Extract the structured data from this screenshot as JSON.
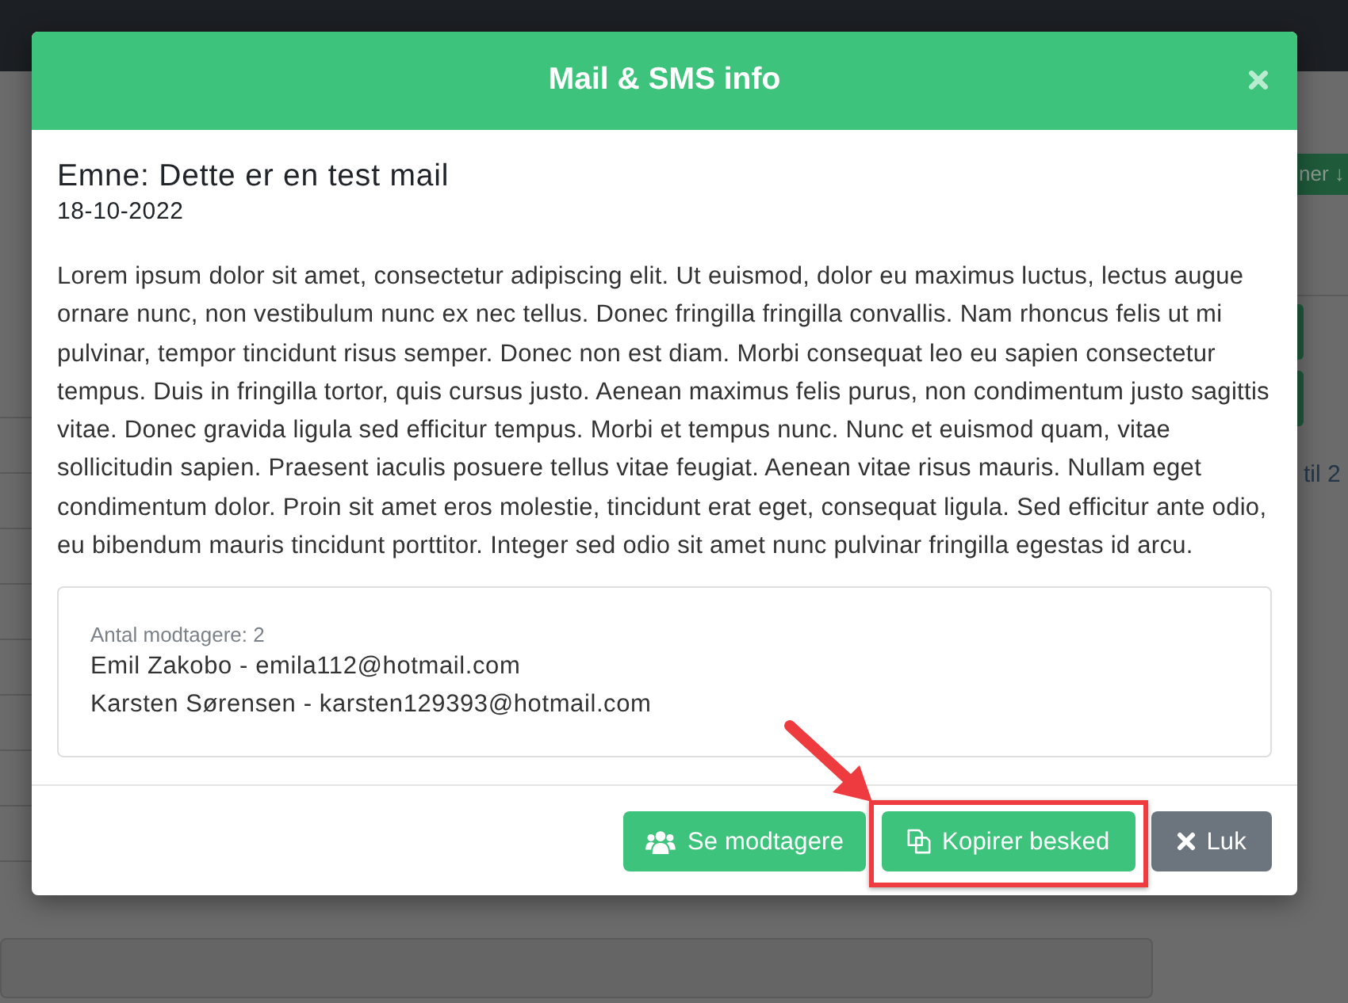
{
  "background": {
    "header_button": "ner ↓",
    "text": "til 2"
  },
  "modal": {
    "title": "Mail & SMS info"
  },
  "message": {
    "subject": "Emne: Dette er en test mail",
    "date": "18-10-2022",
    "body": "Lorem ipsum dolor sit amet, consectetur adipiscing elit. Ut euismod, dolor eu maximus luctus, lectus augue ornare nunc, non vestibulum nunc ex nec tellus. Donec fringilla fringilla convallis. Nam rhoncus felis ut mi pulvinar, tempor tincidunt risus semper. Donec non est diam. Morbi consequat leo eu sapien consectetur tempus. Duis in fringilla tortor, quis cursus justo. Aenean maximus felis purus, non condimentum justo sagittis vitae. Donec gravida ligula sed efficitur tempus. Morbi et tempus nunc. Nunc et euismod quam, vitae sollicitudin sapien. Praesent iaculis posuere tellus vitae feugiat. Aenean vitae risus mauris. Nullam eget condimentum dolor. Proin sit amet eros molestie, tincidunt erat eget, consequat ligula. Sed efficitur ante odio, eu bibendum mauris tincidunt porttitor. Integer sed odio sit amet nunc pulvinar fringilla egestas id arcu."
  },
  "recipients": {
    "count_label": "Antal modtagere: 2",
    "list": [
      "Emil Zakobo - emila112@hotmail.com",
      "Karsten Sørensen - karsten129393@hotmail.com"
    ]
  },
  "buttons": [
    {
      "label": "Se modtagere",
      "kind": "recipients",
      "highlighted": false
    },
    {
      "label": "Kopirer besked",
      "kind": "copy",
      "highlighted": true
    },
    {
      "label": "Luk",
      "kind": "close",
      "highlighted": false
    }
  ]
}
